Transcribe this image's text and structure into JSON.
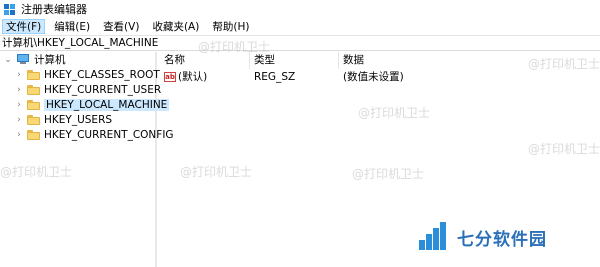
{
  "window": {
    "title": "注册表编辑器"
  },
  "menu": [
    "文件(F)",
    "编辑(E)",
    "查看(V)",
    "收藏夹(A)",
    "帮助(H)"
  ],
  "address": "计算机\\HKEY_LOCAL_MACHINE",
  "tree": {
    "root": "计算机",
    "children": [
      "HKEY_CLASSES_ROOT",
      "HKEY_CURRENT_USER",
      "HKEY_LOCAL_MACHINE",
      "HKEY_USERS",
      "HKEY_CURRENT_CONFIG"
    ],
    "selected": "HKEY_LOCAL_MACHINE"
  },
  "list": {
    "columns": [
      "名称",
      "类型",
      "数据"
    ],
    "rows": [
      {
        "name": "(默认)",
        "type": "REG_SZ",
        "data": "(数值未设置)"
      }
    ]
  },
  "watermark": "@打印机卫士",
  "brand": "七分软件园",
  "colors": {
    "selection": "#cce8ff",
    "brand": "#2a70b8"
  }
}
